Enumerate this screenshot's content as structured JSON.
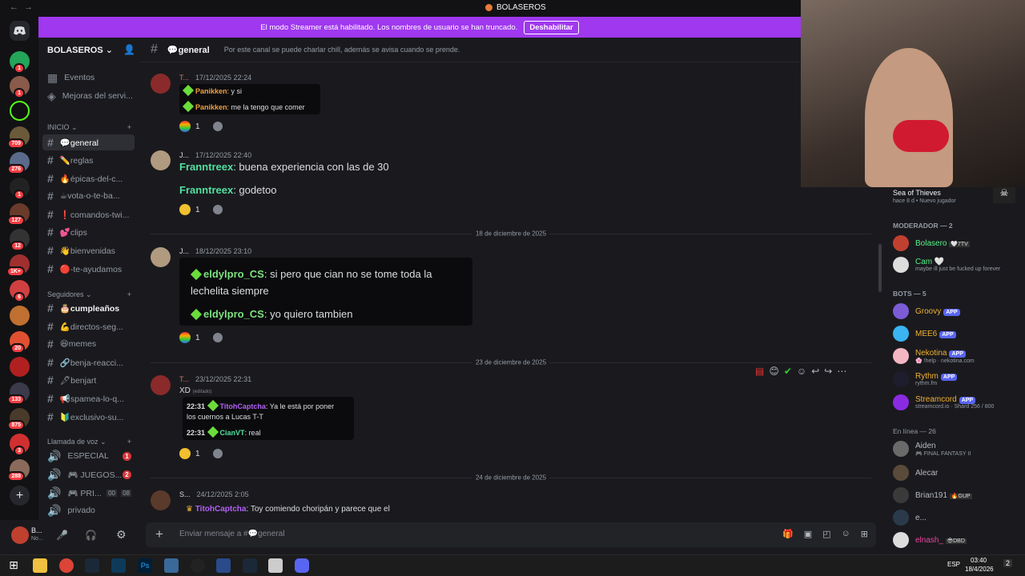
{
  "titlebar": {
    "back": "←",
    "forward": "→",
    "title": "BOLASEROS"
  },
  "streamer_banner": {
    "text": "El modo Streamer está habilitado. Los nombres de usuario se han truncado.",
    "button": "Deshabilitar"
  },
  "guild_badges": [
    "1",
    "1",
    "709",
    "276",
    "1",
    "127",
    "12",
    "1K+",
    "6",
    "20",
    "133",
    "875",
    "3",
    "288"
  ],
  "server": {
    "name": "BOLASEROS"
  },
  "channels": {
    "top": [
      {
        "label": "Eventos"
      },
      {
        "label": "Mejoras del servi..."
      }
    ],
    "cat_inicio": "INICIO",
    "inicio": [
      "💬general",
      "✏️reglas",
      "🔥épicas-del-c...",
      "☕vota-o-te-ba...",
      "❗comandos-twi...",
      "💕clips",
      "👋bienvenidas",
      "🔴-te-ayudamos"
    ],
    "cat_seguidores": "Seguidores",
    "seguidores": [
      "🎂cumpleaños",
      "💪directos-seg...",
      "😆memes",
      "🔗benja-reacci...",
      "🖋benjart",
      "📢spamea-lo-q...",
      "🔰exclusivo-su..."
    ],
    "cat_voz": "Llamada de voz",
    "voz": [
      {
        "label": "ESPECIAL",
        "badge": "1"
      },
      {
        "label": "🎮 JUEGOS...",
        "badge": "2"
      },
      {
        "label": "🎮 PRI...",
        "c1": "00",
        "c2": "08"
      },
      {
        "label": "privado"
      }
    ]
  },
  "user_panel": {
    "name": "B...",
    "status": "No..."
  },
  "chat": {
    "channel": "💬general",
    "topic": "Por este canal se puede charlar chill, además se avisa cuando se prende.",
    "messages": [
      {
        "author": "T...",
        "time": "17/12/2025 22:24",
        "lines": [
          {
            "user": "Panikken",
            "text": ": y si"
          },
          {
            "user": "Panikken",
            "text": ": me la tengo que comer"
          }
        ],
        "reaction": "1"
      },
      {
        "author": "J...",
        "time": "17/12/2025 22:40",
        "lines": [
          {
            "user": "Franntreex",
            "text": ": buena experiencia con las de 30"
          },
          {
            "user": "Franntreex",
            "text": ": godetoo"
          }
        ],
        "reaction": "1"
      },
      {
        "author": "J...",
        "time": "18/12/2025 23:10",
        "lines": [
          {
            "user": "eldylpro_CS",
            "text": ": si pero que cian no se tome toda la"
          },
          {
            "user": "",
            "text": "lechelita siempre"
          },
          {
            "user": "eldylpro_CS",
            "text": ": yo quiero tambien"
          }
        ],
        "reaction": "1"
      },
      {
        "author": "T...",
        "time": "23/12/2025 22:31",
        "text": "XD",
        "edited": "(editado)",
        "lines": [
          {
            "time": "22:31",
            "user": "TitohCaptcha",
            "text": ": Ya le está por poner"
          },
          {
            "user": "",
            "text": "los cuernos a Lucas T-T"
          },
          {
            "time": "22:31",
            "user": "CianVT",
            "text": ": real"
          }
        ],
        "reaction": "1"
      },
      {
        "author": "S...",
        "time": "24/12/2025 2:05",
        "lines": [
          {
            "user": "TitohCaptcha",
            "text": ": Toy comiendo choripán y parece que el"
          }
        ]
      }
    ],
    "dividers": [
      "18 de diciembre de 2025",
      "23 de diciembre de 2025",
      "24 de diciembre de 2025"
    ],
    "input_placeholder": "Enviar mensaje a #💬general"
  },
  "activity": {
    "game": "Sea of Thieves",
    "ago": "hace 8 d",
    "sep": "•",
    "tag": "Nuevo jugador"
  },
  "members": {
    "mod_header": "MODERADOR — 2",
    "mods": [
      {
        "name": "Bolasero",
        "tag": "🤍7TV",
        "color": "#57f287"
      },
      {
        "name": "Cam",
        "tag": "🤍",
        "sub": "maybe ill just be fucked up forever",
        "color": "#57f287"
      }
    ],
    "bots_header": "BOTS — 5",
    "bots": [
      {
        "name": "Groovy",
        "app": "APP",
        "color": "#f0b232"
      },
      {
        "name": "MEE6",
        "app": "APP",
        "color": "#f0b232"
      },
      {
        "name": "Nekotina",
        "app": "APP",
        "sub": "🌸 !help · nekotina.com",
        "color": "#f0b232"
      },
      {
        "name": "Rythm",
        "app": "APP",
        "sub": "rythm.fm",
        "color": "#f0b232"
      },
      {
        "name": "Streamcord",
        "app": "APP",
        "sub": "streamcord.io · Shard 256 / 800",
        "color": "#f0b232"
      }
    ],
    "online_header": "En línea — 26",
    "online": [
      {
        "name": "Aiden",
        "sub": "🎮 FINAL FANTASY II",
        "color": "#b5bac1"
      },
      {
        "name": "Alecar",
        "color": "#b5bac1"
      },
      {
        "name": "Brian191",
        "tag": "🔥GUP",
        "color": "#b5bac1"
      },
      {
        "name": "e...",
        "color": "#b5bac1"
      },
      {
        "name": "elnash_",
        "tag": "😎DBD",
        "color": "#eb459e"
      }
    ]
  },
  "taskbar": {
    "lang": "ESP",
    "time": "03:40",
    "date": "18/4/2026",
    "notif": "2"
  }
}
